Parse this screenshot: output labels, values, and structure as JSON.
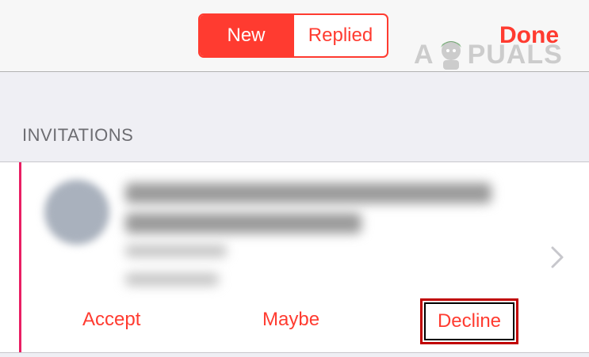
{
  "nav": {
    "segments": [
      {
        "label": "New",
        "active": true
      },
      {
        "label": "Replied",
        "active": false
      }
    ],
    "done_label": "Done"
  },
  "watermark": {
    "text_left": "A",
    "text_right": "PUALS"
  },
  "section_title": "INVITATIONS",
  "invitation": {
    "title": "$19.99 Ray-ban&Oakley Black Friday Deals Online.",
    "from": "From: 3:00",
    "time": "Yesterday",
    "actions": {
      "accept": "Accept",
      "maybe": "Maybe",
      "decline": "Decline"
    }
  },
  "colors": {
    "accent": "#ff3b30",
    "sidebar_bar": "#e91e63",
    "highlight_box": "#c00000"
  }
}
